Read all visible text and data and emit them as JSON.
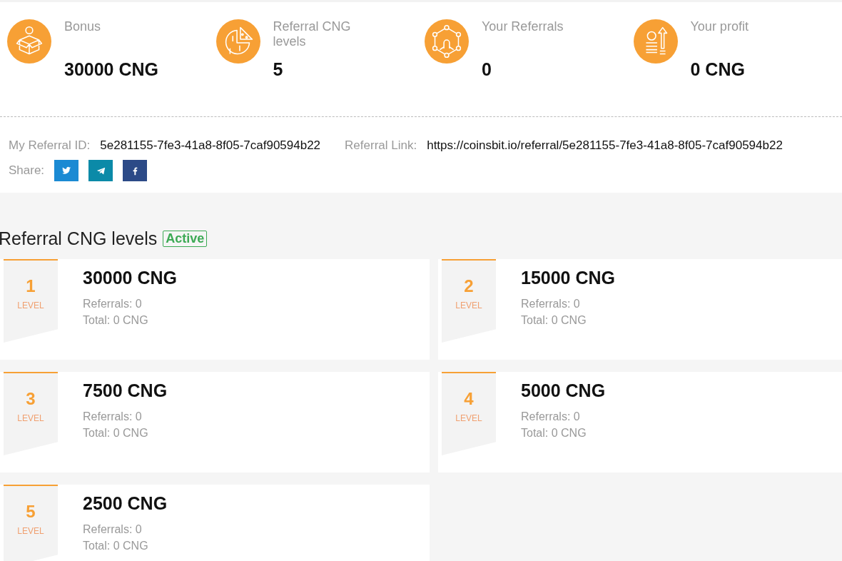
{
  "stats": [
    {
      "kind": "box",
      "label": "Bonus",
      "value": "30000 CNG"
    },
    {
      "kind": "pie",
      "label": "Referral CNG levels",
      "value": "5"
    },
    {
      "kind": "network",
      "label": "Your Referrals",
      "value": "0"
    },
    {
      "kind": "profit",
      "label": "Your profit",
      "value": "0 CNG"
    }
  ],
  "referral": {
    "id_label": "My Referral ID:",
    "id": "5e281155-7fe3-41a8-8f05-7caf90594b22",
    "link_label": "Referral Link:",
    "link": "https://coinsbit.io/referral/5e281155-7fe3-41a8-8f05-7caf90594b22",
    "share_label": "Share:",
    "share": [
      {
        "kind": "twitter"
      },
      {
        "kind": "telegram"
      },
      {
        "kind": "facebook"
      }
    ]
  },
  "levels_section": {
    "title": "Referral CNG levels",
    "badge": {
      "label": "Active",
      "active": true
    }
  },
  "levels": [
    {
      "number": "1",
      "level_label": "LEVEL",
      "amount": "30000 CNG",
      "referrals": "Referrals: 0",
      "total": "Total: 0 CNG"
    },
    {
      "number": "2",
      "level_label": "LEVEL",
      "amount": "15000 CNG",
      "referrals": "Referrals: 0",
      "total": "Total: 0 CNG"
    },
    {
      "number": "3",
      "level_label": "LEVEL",
      "amount": "7500 CNG",
      "referrals": "Referrals: 0",
      "total": "Total: 0 CNG"
    },
    {
      "number": "4",
      "level_label": "LEVEL",
      "amount": "5000 CNG",
      "referrals": "Referrals: 0",
      "total": "Total: 0 CNG"
    },
    {
      "number": "5",
      "level_label": "LEVEL",
      "amount": "2500 CNG",
      "referrals": "Referrals: 0",
      "total": "Total: 0 CNG"
    }
  ]
}
